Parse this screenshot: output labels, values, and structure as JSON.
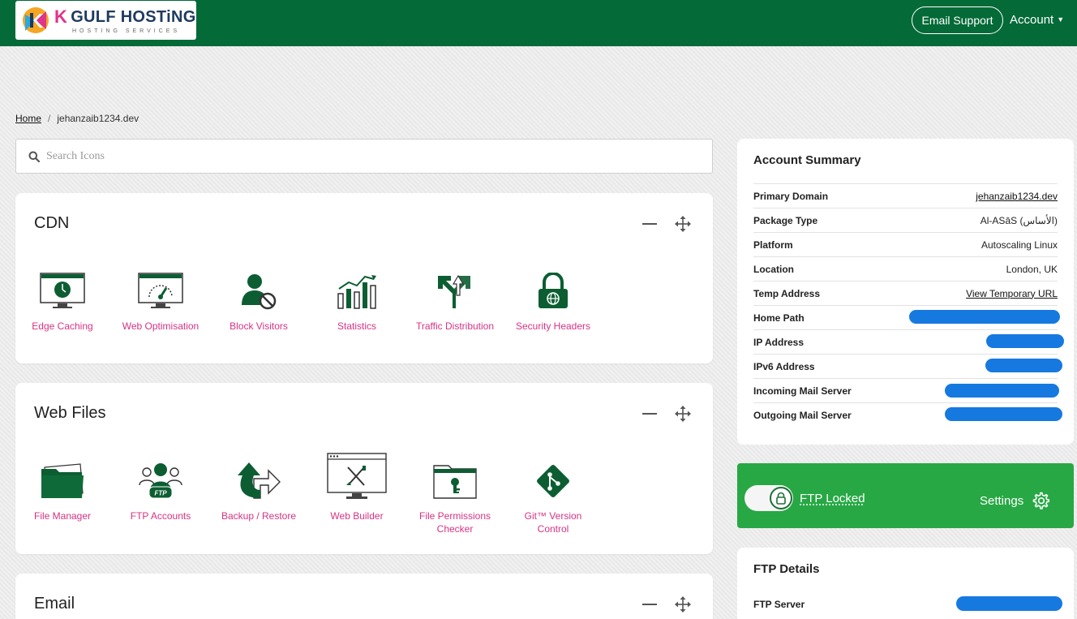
{
  "header": {
    "brand_title": "GULF HOSTiNG",
    "brand_subtitle": "HOSTING SERVICES",
    "email_support": "Email Support",
    "account": "Account"
  },
  "breadcrumb": {
    "home": "Home",
    "current": "jehanzaib1234.dev"
  },
  "search": {
    "placeholder": "Search Icons",
    "value": ""
  },
  "sections": [
    {
      "title": "CDN",
      "tiles": [
        {
          "label": "Edge Caching",
          "icon": "monitor-clock-icon"
        },
        {
          "label": "Web Optimisation",
          "icon": "speed-gauge-icon"
        },
        {
          "label": "Block Visitors",
          "icon": "block-user-icon"
        },
        {
          "label": "Statistics",
          "icon": "bar-chart-icon"
        },
        {
          "label": "Traffic Distribution",
          "icon": "split-arrows-icon"
        },
        {
          "label": "Security Headers",
          "icon": "padlock-icon"
        }
      ]
    },
    {
      "title": "Web Files",
      "tiles": [
        {
          "label": "File Manager",
          "icon": "folder-icon"
        },
        {
          "label": "FTP Accounts",
          "icon": "ftp-users-icon"
        },
        {
          "label": "Backup / Restore",
          "icon": "backup-arrow-icon"
        },
        {
          "label": "Web Builder",
          "icon": "web-builder-icon"
        },
        {
          "label": "File Permissions Checker",
          "icon": "folder-key-icon"
        },
        {
          "label": "Git™ Version Control",
          "icon": "git-icon"
        }
      ]
    },
    {
      "title": "Email",
      "tiles": []
    }
  ],
  "account_summary": {
    "title": "Account Summary",
    "rows": [
      {
        "key": "Primary Domain",
        "value": "jehanzaib1234.dev",
        "link": true
      },
      {
        "key": "Package Type",
        "value": "Al-ASāS (الأساس)",
        "link": false
      },
      {
        "key": "Platform",
        "value": "Autoscaling Linux",
        "link": false
      },
      {
        "key": "Location",
        "value": "London, UK",
        "link": false
      },
      {
        "key": "Temp Address",
        "value": "View Temporary URL",
        "link": true
      },
      {
        "key": "Home Path",
        "value": "",
        "link": false
      },
      {
        "key": "IP Address",
        "value": "",
        "link": false
      },
      {
        "key": "IPv6 Address",
        "value": "",
        "link": false
      },
      {
        "key": "Incoming Mail Server",
        "value": "",
        "link": false
      },
      {
        "key": "Outgoing Mail Server",
        "value": "",
        "link": false
      }
    ]
  },
  "ftp_lock": {
    "label": "FTP Locked",
    "settings": "Settings",
    "locked": true
  },
  "ftp_details": {
    "title": "FTP Details",
    "rows": [
      {
        "key": "FTP Server",
        "value": ""
      }
    ]
  },
  "colors": {
    "header": "#046a38",
    "accent": "#d63384",
    "icon": "#0c5e32",
    "ftp_lock_bg": "#27a844",
    "redaction": "#1679df"
  }
}
